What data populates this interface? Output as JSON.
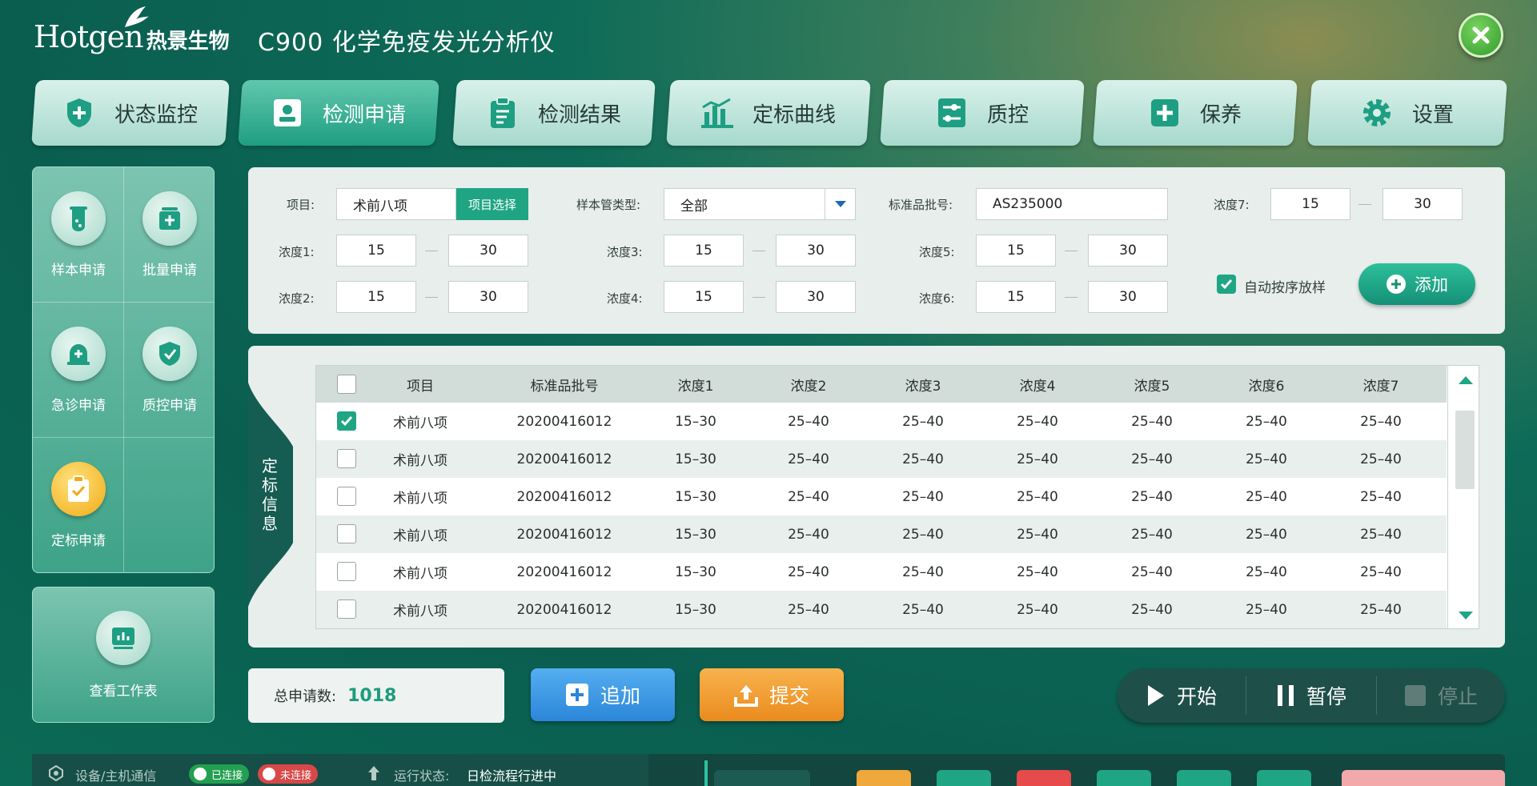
{
  "brand": {
    "logo_en": "Hotgen",
    "logo_cn": "热景生物",
    "title": "C900 化学免疫发光分析仪"
  },
  "tabs": [
    {
      "label": "状态监控",
      "icon": "shield-plus-icon"
    },
    {
      "label": "检测申请",
      "icon": "id-card-icon",
      "active": true
    },
    {
      "label": "检测结果",
      "icon": "clipboard-icon"
    },
    {
      "label": "定标曲线",
      "icon": "bar-chart-icon"
    },
    {
      "label": "质控",
      "icon": "sliders-icon"
    },
    {
      "label": "保养",
      "icon": "medical-plus-icon"
    },
    {
      "label": "设置",
      "icon": "gear-icon"
    }
  ],
  "sidebar": {
    "items": [
      {
        "label": "样本申请",
        "icon": "flask-icon"
      },
      {
        "label": "批量申请",
        "icon": "batch-icon"
      },
      {
        "label": "急诊申请",
        "icon": "alarm-icon"
      },
      {
        "label": "质控申请",
        "icon": "shield-check-icon"
      },
      {
        "label": "定标申请",
        "icon": "clipboard-check-icon",
        "active": true
      }
    ],
    "worksheet_label": "查看工作表"
  },
  "form": {
    "project_label": "项目:",
    "project_value": "术前八项",
    "project_select_btn": "项目选择",
    "tube_type_label": "样本管类型:",
    "tube_type_value": "全部",
    "lot_label": "标准品批号:",
    "lot_value": "AS235000",
    "concentrations": [
      {
        "label": "浓度1:",
        "min": "15",
        "max": "30"
      },
      {
        "label": "浓度2:",
        "min": "15",
        "max": "30"
      },
      {
        "label": "浓度3:",
        "min": "15",
        "max": "30"
      },
      {
        "label": "浓度4:",
        "min": "15",
        "max": "30"
      },
      {
        "label": "浓度5:",
        "min": "15",
        "max": "30"
      },
      {
        "label": "浓度6:",
        "min": "15",
        "max": "30"
      },
      {
        "label": "浓度7:",
        "min": "15",
        "max": "30"
      }
    ],
    "auto_sort_label": "自动按序放样",
    "add_btn": "添加"
  },
  "table": {
    "side_label": "定标信息",
    "headers": [
      "项目",
      "标准品批号",
      "浓度1",
      "浓度2",
      "浓度3",
      "浓度4",
      "浓度5",
      "浓度6",
      "浓度7"
    ],
    "rows": [
      {
        "checked": true,
        "cells": [
          "术前八项",
          "20200416012",
          "15–30",
          "25–40",
          "25–40",
          "25–40",
          "25–40",
          "25–40",
          "25–40"
        ]
      },
      {
        "checked": false,
        "cells": [
          "术前八项",
          "20200416012",
          "15–30",
          "25–40",
          "25–40",
          "25–40",
          "25–40",
          "25–40",
          "25–40"
        ]
      },
      {
        "checked": false,
        "cells": [
          "术前八项",
          "20200416012",
          "15–30",
          "25–40",
          "25–40",
          "25–40",
          "25–40",
          "25–40",
          "25–40"
        ]
      },
      {
        "checked": false,
        "cells": [
          "术前八项",
          "20200416012",
          "15–30",
          "25–40",
          "25–40",
          "25–40",
          "25–40",
          "25–40",
          "25–40"
        ]
      },
      {
        "checked": false,
        "cells": [
          "术前八项",
          "20200416012",
          "15–30",
          "25–40",
          "25–40",
          "25–40",
          "25–40",
          "25–40",
          "25–40"
        ]
      },
      {
        "checked": false,
        "cells": [
          "术前八项",
          "20200416012",
          "15–30",
          "25–40",
          "25–40",
          "25–40",
          "25–40",
          "25–40",
          "25–40"
        ]
      }
    ]
  },
  "footer": {
    "total_label": "总申请数:",
    "total_value": "1018",
    "append_btn": "追加",
    "submit_btn": "提交",
    "start_btn": "开始",
    "pause_btn": "暂停",
    "stop_btn": "停止"
  },
  "status": {
    "comm_label": "设备/主机通信",
    "connected": "已连接",
    "disconnected": "未连接",
    "run_label": "运行状态:",
    "run_value": "日检流程行进中"
  },
  "colors": {
    "accent": "#1fa584",
    "append": "#2b86d9",
    "submit": "#ea8b1d",
    "danger": "#e64a4a"
  }
}
